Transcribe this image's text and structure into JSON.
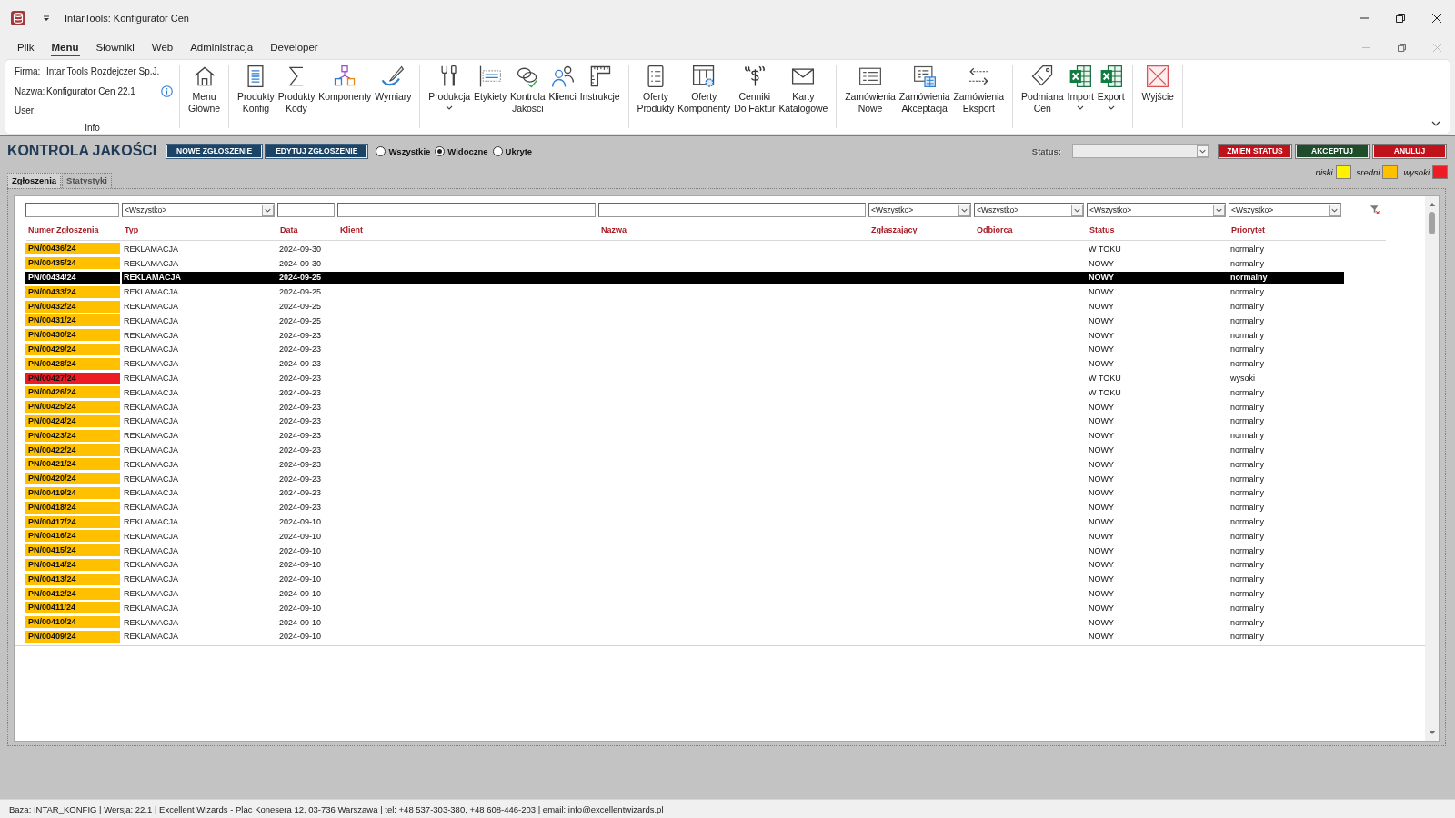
{
  "window": {
    "title": "IntarTools: Konfigurator Cen"
  },
  "menu_tabs": [
    {
      "label": "Plik",
      "selected": false
    },
    {
      "label": "Menu",
      "selected": true
    },
    {
      "label": "Słowniki",
      "selected": false
    },
    {
      "label": "Web",
      "selected": false
    },
    {
      "label": "Administracja",
      "selected": false
    },
    {
      "label": "Developer",
      "selected": false
    }
  ],
  "ribbon": {
    "info": {
      "label": "Info",
      "fields": [
        {
          "label": "Firma:",
          "value": "Intar Tools Rozdejczer Sp.J."
        },
        {
          "label": "Nazwa:",
          "value": "Konfigurator Cen 22.1"
        },
        {
          "label": "User:"
        }
      ]
    },
    "groups": [
      {
        "items": [
          {
            "label": "Menu Główne",
            "dropdown": false
          }
        ]
      },
      {
        "items": [
          {
            "label": "Produkty Konfig",
            "dropdown": false
          },
          {
            "label": "Produkty Kody",
            "dropdown": false
          },
          {
            "label": "Komponenty",
            "dropdown": false
          },
          {
            "label": "Wymiary",
            "dropdown": false
          }
        ]
      },
      {
        "items": [
          {
            "label": "Produkcja",
            "dropdown": true
          },
          {
            "label": "Etykiety",
            "dropdown": false
          },
          {
            "label": "Kontrola Jakosci",
            "dropdown": false
          },
          {
            "label": "Klienci",
            "dropdown": false
          },
          {
            "label": "Instrukcje",
            "dropdown": false
          }
        ]
      },
      {
        "items": [
          {
            "label": "Oferty Produkty",
            "dropdown": false
          },
          {
            "label": "Oferty Komponenty",
            "dropdown": false
          },
          {
            "label": "Cenniki Do Faktur",
            "dropdown": false
          },
          {
            "label": "Karty Katalogowe",
            "dropdown": false
          }
        ]
      },
      {
        "items": [
          {
            "label": "Zamówienia Nowe",
            "dropdown": false
          },
          {
            "label": "Zamówienia Akceptacja",
            "dropdown": false
          },
          {
            "label": "Zamówienia Eksport",
            "dropdown": false
          }
        ]
      },
      {
        "items": [
          {
            "label": "Podmiana Cen",
            "dropdown": false
          },
          {
            "label": "Import",
            "dropdown": true
          },
          {
            "label": "Export",
            "dropdown": true
          }
        ]
      },
      {
        "items": [
          {
            "label": "Wyjście",
            "dropdown": false
          }
        ]
      }
    ]
  },
  "toolbar": {
    "title": "KONTROLA JAKOŚCI",
    "actions": [
      "NOWE ZGŁOSZENIE",
      "EDYTUJ ZGŁOSZENIE"
    ],
    "visibility": [
      {
        "label": "Wszystkie",
        "selected": false
      },
      {
        "label": "Widoczne",
        "selected": true
      },
      {
        "label": "Ukryte",
        "selected": false
      }
    ],
    "status": {
      "label": "Status:",
      "disabled": true
    },
    "status_buttons": [
      {
        "label": "ZMIEN STATUS",
        "kind": "danger"
      },
      {
        "label": "AKCEPTUJ",
        "kind": "confirm"
      },
      {
        "label": "ANULUJ",
        "kind": "danger"
      }
    ]
  },
  "legend": [
    {
      "label": "niski",
      "color": "#fff200"
    },
    {
      "label": "sredni",
      "color": "#ffc000"
    },
    {
      "label": "wysoki",
      "color": "#ed1c24"
    }
  ],
  "tabs": [
    {
      "label": "Zgłoszenia",
      "selected": true
    },
    {
      "label": "Statystyki",
      "selected": false
    }
  ],
  "table": {
    "filters": [
      {
        "kind": "text"
      },
      {
        "kind": "combo",
        "value": "<Wszystko>"
      },
      {
        "kind": "text"
      },
      {
        "kind": "text"
      },
      {
        "kind": "text"
      },
      {
        "kind": "combo",
        "value": "<Wszystko>"
      },
      {
        "kind": "combo",
        "value": "<Wszystko>"
      },
      {
        "kind": "combo",
        "value": "<Wszystko>"
      },
      {
        "kind": "combo",
        "value": "<Wszystko>"
      }
    ],
    "columns": [
      "Numer Zgłoszenia",
      "Typ",
      "Data",
      "Klient",
      "Nazwa",
      "Zgłaszający",
      "Odbiorca",
      "Status",
      "Priorytet"
    ],
    "rows": [
      {
        "number": "PN/00436/24",
        "type": "REKLAMACJA",
        "date": "2024-09-30",
        "status": "W TOKU",
        "priority": "normalny",
        "color": "#ffc000",
        "selected": false
      },
      {
        "number": "PN/00435/24",
        "type": "REKLAMACJA",
        "date": "2024-09-30",
        "status": "NOWY",
        "priority": "normalny",
        "color": "#ffc000",
        "selected": false
      },
      {
        "number": "PN/00434/24",
        "type": "REKLAMACJA",
        "date": "2024-09-25",
        "status": "NOWY",
        "priority": "normalny",
        "selected": true
      },
      {
        "number": "PN/00433/24",
        "type": "REKLAMACJA",
        "date": "2024-09-25",
        "status": "NOWY",
        "priority": "normalny",
        "color": "#ffc000",
        "selected": false
      },
      {
        "number": "PN/00432/24",
        "type": "REKLAMACJA",
        "date": "2024-09-25",
        "status": "NOWY",
        "priority": "normalny",
        "color": "#ffc000",
        "selected": false
      },
      {
        "number": "PN/00431/24",
        "type": "REKLAMACJA",
        "date": "2024-09-25",
        "status": "NOWY",
        "priority": "normalny",
        "color": "#ffc000",
        "selected": false
      },
      {
        "number": "PN/00430/24",
        "type": "REKLAMACJA",
        "date": "2024-09-23",
        "status": "NOWY",
        "priority": "normalny",
        "color": "#ffc000",
        "selected": false
      },
      {
        "number": "PN/00429/24",
        "type": "REKLAMACJA",
        "date": "2024-09-23",
        "status": "NOWY",
        "priority": "normalny",
        "color": "#ffc000",
        "selected": false
      },
      {
        "number": "PN/00428/24",
        "type": "REKLAMACJA",
        "date": "2024-09-23",
        "status": "NOWY",
        "priority": "normalny",
        "color": "#ffc000",
        "selected": false
      },
      {
        "number": "PN/00427/24",
        "type": "REKLAMACJA",
        "date": "2024-09-23",
        "status": "W TOKU",
        "priority": "wysoki",
        "color": "#ed1c24",
        "selected": false
      },
      {
        "number": "PN/00426/24",
        "type": "REKLAMACJA",
        "date": "2024-09-23",
        "status": "W TOKU",
        "priority": "normalny",
        "color": "#ffc000",
        "selected": false
      },
      {
        "number": "PN/00425/24",
        "type": "REKLAMACJA",
        "date": "2024-09-23",
        "status": "NOWY",
        "priority": "normalny",
        "color": "#ffc000",
        "selected": false
      },
      {
        "number": "PN/00424/24",
        "type": "REKLAMACJA",
        "date": "2024-09-23",
        "status": "NOWY",
        "priority": "normalny",
        "color": "#ffc000",
        "selected": false
      },
      {
        "number": "PN/00423/24",
        "type": "REKLAMACJA",
        "date": "2024-09-23",
        "status": "NOWY",
        "priority": "normalny",
        "color": "#ffc000",
        "selected": false
      },
      {
        "number": "PN/00422/24",
        "type": "REKLAMACJA",
        "date": "2024-09-23",
        "status": "NOWY",
        "priority": "normalny",
        "color": "#ffc000",
        "selected": false
      },
      {
        "number": "PN/00421/24",
        "type": "REKLAMACJA",
        "date": "2024-09-23",
        "status": "NOWY",
        "priority": "normalny",
        "color": "#ffc000",
        "selected": false
      },
      {
        "number": "PN/00420/24",
        "type": "REKLAMACJA",
        "date": "2024-09-23",
        "status": "NOWY",
        "priority": "normalny",
        "color": "#ffc000",
        "selected": false
      },
      {
        "number": "PN/00419/24",
        "type": "REKLAMACJA",
        "date": "2024-09-23",
        "status": "NOWY",
        "priority": "normalny",
        "color": "#ffc000",
        "selected": false
      },
      {
        "number": "PN/00418/24",
        "type": "REKLAMACJA",
        "date": "2024-09-23",
        "status": "NOWY",
        "priority": "normalny",
        "color": "#ffc000",
        "selected": false
      },
      {
        "number": "PN/00417/24",
        "type": "REKLAMACJA",
        "date": "2024-09-10",
        "status": "NOWY",
        "priority": "normalny",
        "color": "#ffc000",
        "selected": false
      },
      {
        "number": "PN/00416/24",
        "type": "REKLAMACJA",
        "date": "2024-09-10",
        "status": "NOWY",
        "priority": "normalny",
        "color": "#ffc000",
        "selected": false
      },
      {
        "number": "PN/00415/24",
        "type": "REKLAMACJA",
        "date": "2024-09-10",
        "status": "NOWY",
        "priority": "normalny",
        "color": "#ffc000",
        "selected": false
      },
      {
        "number": "PN/00414/24",
        "type": "REKLAMACJA",
        "date": "2024-09-10",
        "status": "NOWY",
        "priority": "normalny",
        "color": "#ffc000",
        "selected": false
      },
      {
        "number": "PN/00413/24",
        "type": "REKLAMACJA",
        "date": "2024-09-10",
        "status": "NOWY",
        "priority": "normalny",
        "color": "#ffc000",
        "selected": false
      },
      {
        "number": "PN/00412/24",
        "type": "REKLAMACJA",
        "date": "2024-09-10",
        "status": "NOWY",
        "priority": "normalny",
        "color": "#ffc000",
        "selected": false
      },
      {
        "number": "PN/00411/24",
        "type": "REKLAMACJA",
        "date": "2024-09-10",
        "status": "NOWY",
        "priority": "normalny",
        "color": "#ffc000",
        "selected": false
      },
      {
        "number": "PN/00410/24",
        "type": "REKLAMACJA",
        "date": "2024-09-10",
        "status": "NOWY",
        "priority": "normalny",
        "color": "#ffc000",
        "selected": false
      },
      {
        "number": "PN/00409/24",
        "type": "REKLAMACJA",
        "date": "2024-09-10",
        "status": "NOWY",
        "priority": "normalny",
        "color": "#ffc000",
        "selected": false
      }
    ]
  },
  "status_bar": {
    "text": "Baza: INTAR_KONFIG | Wersja: 22.1 | Excellent Wizards - Plac Konesera 12, 03-736 Warszawa | tel: +48 537-303-380, +48 608-446-203 | email: info@excellentwizards.pl |"
  }
}
